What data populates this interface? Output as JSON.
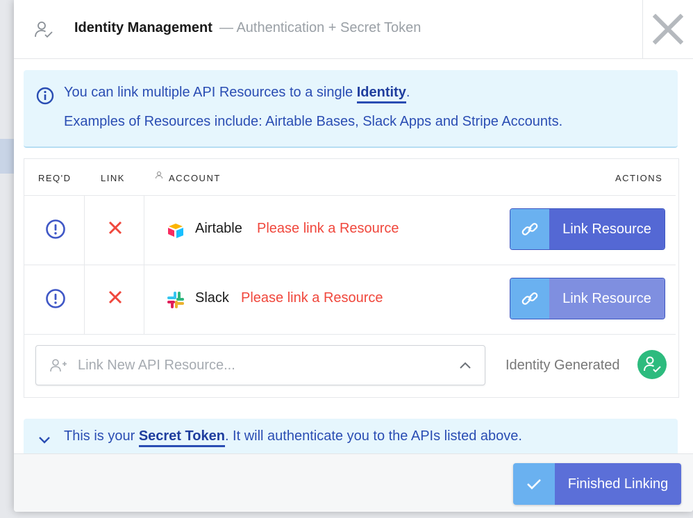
{
  "header": {
    "title": "Identity Management",
    "subtitle": "— Authentication + Secret Token",
    "close_icon": "close-icon"
  },
  "info": {
    "line1_prefix": "You can link multiple API Resources to a single ",
    "line1_highlight": "Identity",
    "line1_suffix": ".",
    "line2": "Examples of Resources include: Airtable Bases, Slack Apps and Stripe Accounts."
  },
  "table": {
    "headers": {
      "required": "REQ'D",
      "link": "LINK",
      "account": "ACCOUNT",
      "actions": "ACTIONS"
    },
    "rows": [
      {
        "name": "Airtable",
        "status": "Please link a Resource",
        "action_label": "Link Resource",
        "action_color": "#5468d4"
      },
      {
        "name": "Slack",
        "status": "Please link a Resource",
        "action_label": "Link Resource",
        "action_color": "#7f8fe0"
      }
    ]
  },
  "link_new": {
    "placeholder": "Link New API Resource...",
    "identity_label": "Identity Generated"
  },
  "secret": {
    "prefix": "This is your ",
    "highlight": "Secret Token",
    "suffix": ". It will authenticate you to the APIs listed above."
  },
  "footer": {
    "finish_label": "Finished Linking"
  },
  "colors": {
    "accent": "#5b6fd8",
    "icon_accent": "#6ab1f0",
    "warning": "#f0473c",
    "success": "#2dbb7e",
    "info_text": "#2a4db3"
  }
}
